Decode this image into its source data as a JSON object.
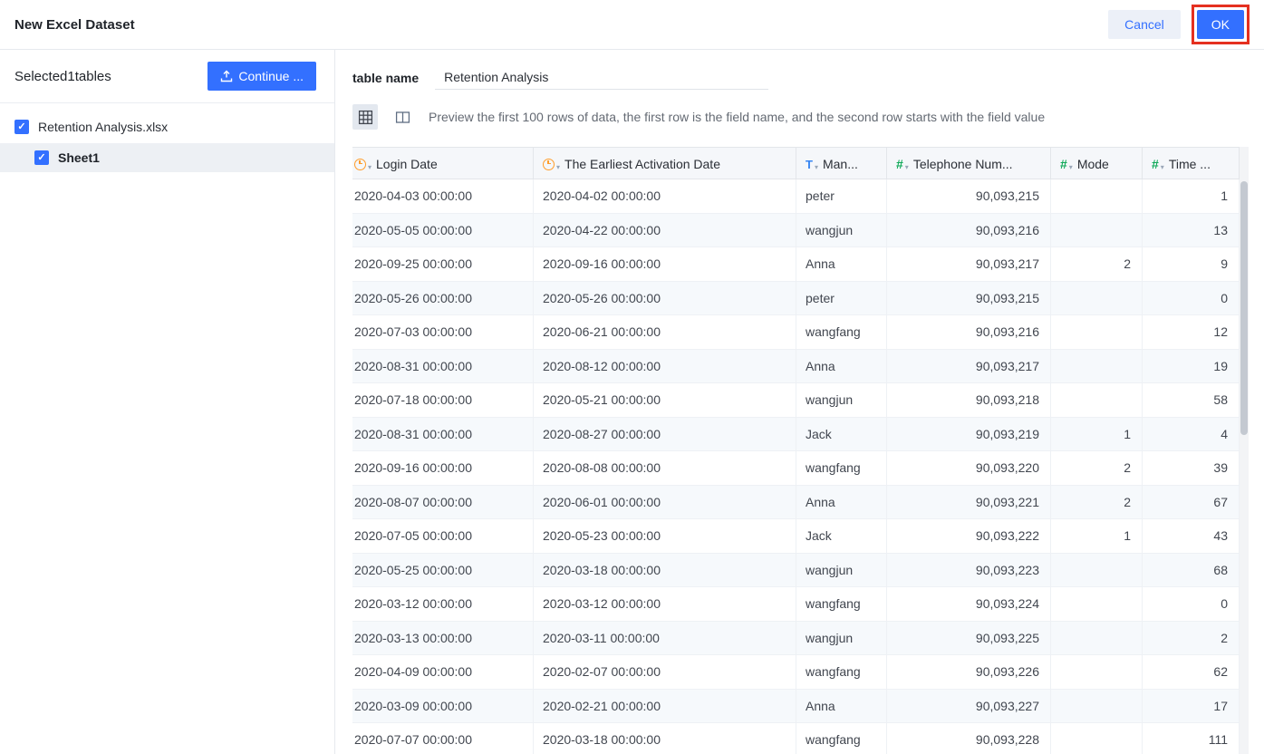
{
  "header": {
    "title": "New Excel Dataset",
    "cancel_label": "Cancel",
    "ok_label": "OK"
  },
  "sidebar": {
    "selected_text": "Selected1tables",
    "continue_label": "Continue ...",
    "file": {
      "name": "Retention Analysis.xlsx",
      "checked": true
    },
    "sheet": {
      "name": "Sheet1",
      "checked": true
    }
  },
  "main": {
    "table_name_label": "table name",
    "table_name_value": "Retention Analysis",
    "preview_hint": "Preview the first 100 rows of data, the first row is the field name, and the second row starts with the field value"
  },
  "table": {
    "columns": [
      {
        "name": "Login Date",
        "type": "date",
        "icon": "clock-icon",
        "align": "left"
      },
      {
        "name": "The Earliest Activation Date",
        "type": "date",
        "icon": "clock-icon",
        "align": "left"
      },
      {
        "name": "Man...",
        "type": "text",
        "icon": "text-type-icon",
        "align": "left"
      },
      {
        "name": "Telephone Num...",
        "type": "number",
        "icon": "number-type-icon",
        "align": "right"
      },
      {
        "name": "Mode",
        "type": "number",
        "icon": "number-type-icon",
        "align": "right"
      },
      {
        "name": "Time ...",
        "type": "number",
        "icon": "number-type-icon",
        "align": "right"
      }
    ],
    "rows": [
      [
        "2020-04-03 00:00:00",
        "2020-04-02 00:00:00",
        "peter",
        "90,093,215",
        "",
        "1"
      ],
      [
        "2020-05-05 00:00:00",
        "2020-04-22 00:00:00",
        "wangjun",
        "90,093,216",
        "",
        "13"
      ],
      [
        "2020-09-25 00:00:00",
        "2020-09-16 00:00:00",
        "Anna",
        "90,093,217",
        "2",
        "9"
      ],
      [
        "2020-05-26 00:00:00",
        "2020-05-26 00:00:00",
        "peter",
        "90,093,215",
        "",
        "0"
      ],
      [
        "2020-07-03 00:00:00",
        "2020-06-21 00:00:00",
        "wangfang",
        "90,093,216",
        "",
        "12"
      ],
      [
        "2020-08-31 00:00:00",
        "2020-08-12 00:00:00",
        "Anna",
        "90,093,217",
        "",
        "19"
      ],
      [
        "2020-07-18 00:00:00",
        "2020-05-21 00:00:00",
        "wangjun",
        "90,093,218",
        "",
        "58"
      ],
      [
        "2020-08-31 00:00:00",
        "2020-08-27 00:00:00",
        "Jack",
        "90,093,219",
        "1",
        "4"
      ],
      [
        "2020-09-16 00:00:00",
        "2020-08-08 00:00:00",
        "wangfang",
        "90,093,220",
        "2",
        "39"
      ],
      [
        "2020-08-07 00:00:00",
        "2020-06-01 00:00:00",
        "Anna",
        "90,093,221",
        "2",
        "67"
      ],
      [
        "2020-07-05 00:00:00",
        "2020-05-23 00:00:00",
        "Jack",
        "90,093,222",
        "1",
        "43"
      ],
      [
        "2020-05-25 00:00:00",
        "2020-03-18 00:00:00",
        "wangjun",
        "90,093,223",
        "",
        "68"
      ],
      [
        "2020-03-12 00:00:00",
        "2020-03-12 00:00:00",
        "wangfang",
        "90,093,224",
        "",
        "0"
      ],
      [
        "2020-03-13 00:00:00",
        "2020-03-11 00:00:00",
        "wangjun",
        "90,093,225",
        "",
        "2"
      ],
      [
        "2020-04-09 00:00:00",
        "2020-02-07 00:00:00",
        "wangfang",
        "90,093,226",
        "",
        "62"
      ],
      [
        "2020-03-09 00:00:00",
        "2020-02-21 00:00:00",
        "Anna",
        "90,093,227",
        "",
        "17"
      ],
      [
        "2020-07-07 00:00:00",
        "2020-03-18 00:00:00",
        "wangfang",
        "90,093,228",
        "",
        "111"
      ]
    ]
  },
  "colors": {
    "accent_blue": "#3370ff",
    "annotation_red": "#e53020",
    "date_icon_orange": "#ff9d2b",
    "text_icon_blue": "#3685f2",
    "number_icon_green": "#0fa958"
  }
}
